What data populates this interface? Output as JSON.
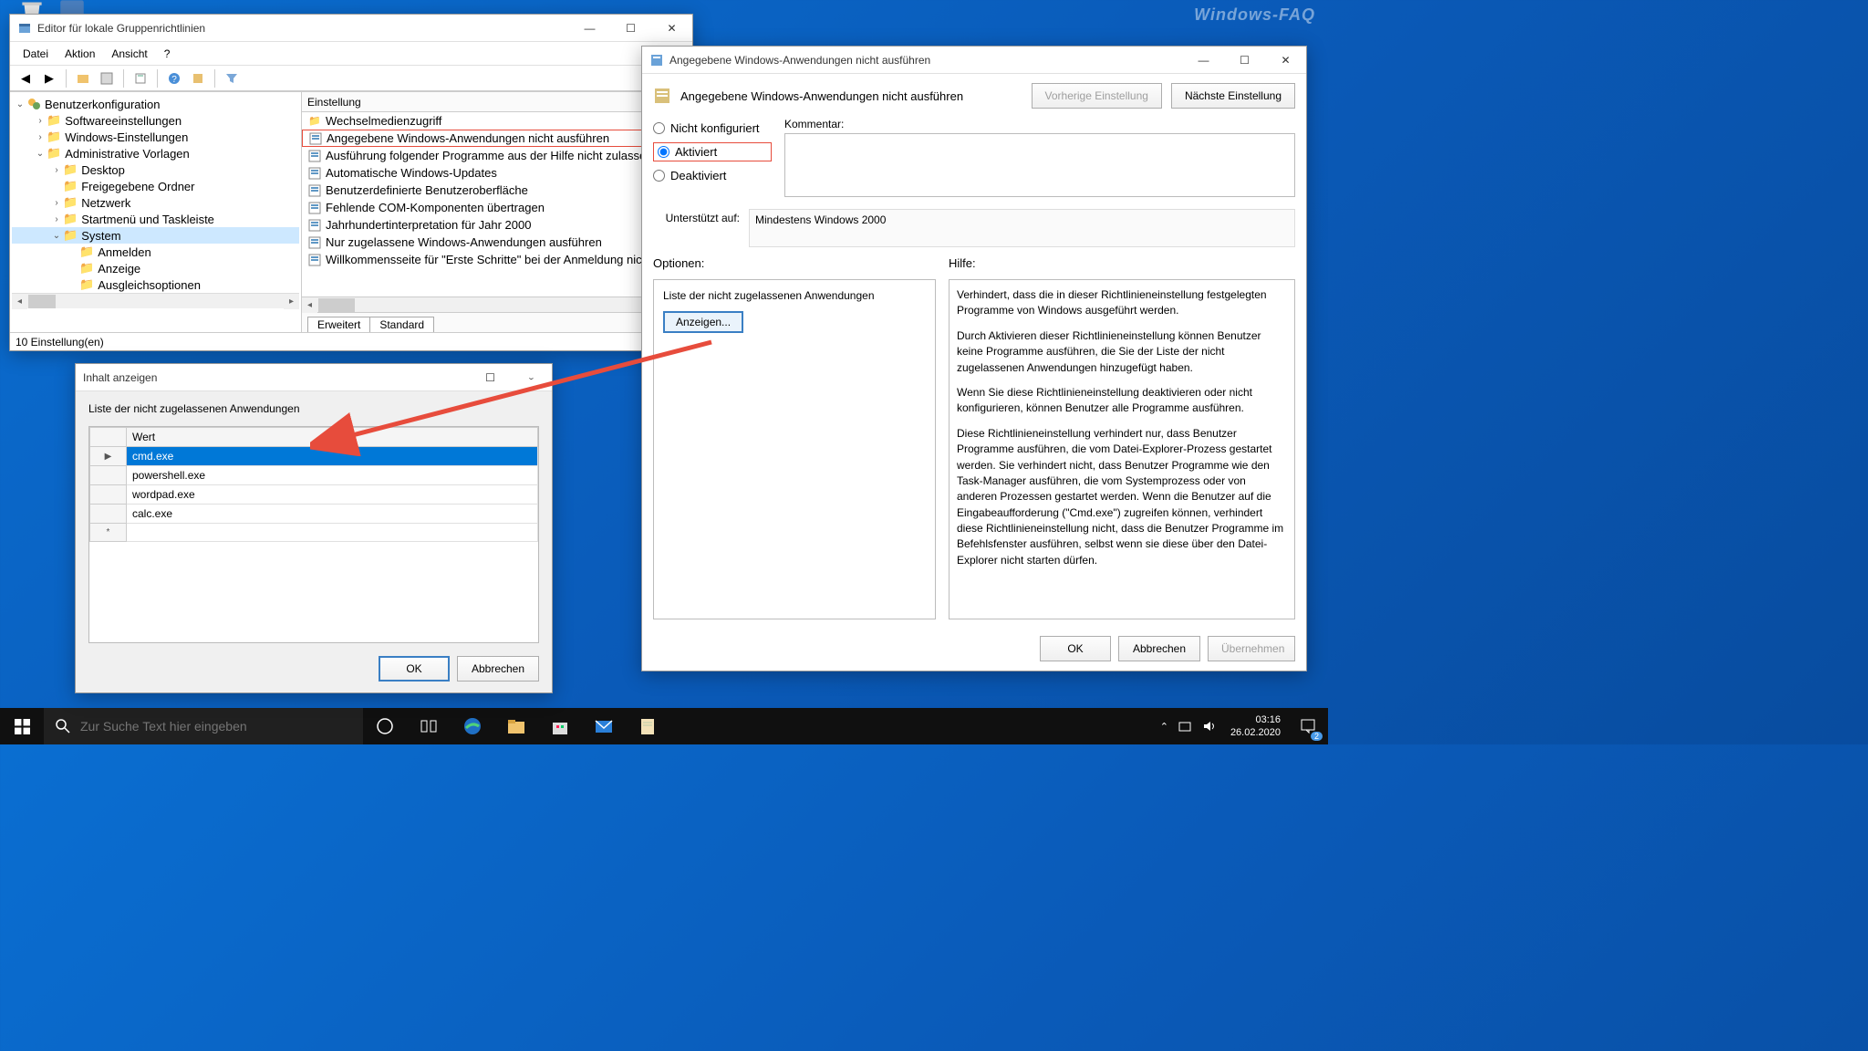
{
  "watermark": "Windows-FAQ",
  "desktop": {
    "icons": [
      "recycle-bin",
      "this-pc"
    ]
  },
  "gpe": {
    "title": "Editor für lokale Gruppenrichtlinien",
    "menus": [
      "Datei",
      "Aktion",
      "Ansicht",
      "?"
    ],
    "tree": {
      "root": "Benutzerkonfiguration",
      "nodes": [
        {
          "label": "Softwareeinstellungen",
          "level": 1,
          "exp": "›"
        },
        {
          "label": "Windows-Einstellungen",
          "level": 1,
          "exp": "›"
        },
        {
          "label": "Administrative Vorlagen",
          "level": 1,
          "exp": "v"
        },
        {
          "label": "Desktop",
          "level": 2,
          "exp": "›"
        },
        {
          "label": "Freigegebene Ordner",
          "level": 2,
          "exp": ""
        },
        {
          "label": "Netzwerk",
          "level": 2,
          "exp": "›"
        },
        {
          "label": "Startmenü und Taskleiste",
          "level": 2,
          "exp": "›"
        },
        {
          "label": "System",
          "level": 2,
          "exp": "v",
          "sel": true
        },
        {
          "label": "Anmelden",
          "level": 3,
          "exp": ""
        },
        {
          "label": "Anzeige",
          "level": 3,
          "exp": ""
        },
        {
          "label": "Ausgleichsoptionen",
          "level": 3,
          "exp": ""
        }
      ]
    },
    "list_header": "Einstellung",
    "settings": [
      {
        "icon": "folder",
        "label": "Wechselmedienzugriff"
      },
      {
        "icon": "policy",
        "label": "Angegebene Windows-Anwendungen nicht ausführen",
        "hl": true
      },
      {
        "icon": "policy",
        "label": "Ausführung folgender Programme aus der Hilfe nicht zulassen"
      },
      {
        "icon": "policy",
        "label": "Automatische Windows-Updates"
      },
      {
        "icon": "policy",
        "label": "Benutzerdefinierte Benutzeroberfläche"
      },
      {
        "icon": "policy",
        "label": "Fehlende COM-Komponenten übertragen"
      },
      {
        "icon": "policy",
        "label": "Jahrhundertinterpretation für Jahr 2000"
      },
      {
        "icon": "policy",
        "label": "Nur zugelassene Windows-Anwendungen ausführen"
      },
      {
        "icon": "policy",
        "label": "Willkommensseite für \"Erste Schritte\" bei der Anmeldung nic..."
      }
    ],
    "tabs": [
      "Erweitert",
      "Standard"
    ],
    "status": "10 Einstellung(en)"
  },
  "policy": {
    "title": "Angegebene Windows-Anwendungen nicht ausführen",
    "heading": "Angegebene Windows-Anwendungen nicht ausführen",
    "prev_btn": "Vorherige Einstellung",
    "next_btn": "Nächste Einstellung",
    "radio_not_configured": "Nicht konfiguriert",
    "radio_enabled": "Aktiviert",
    "radio_disabled": "Deaktiviert",
    "selected": "enabled",
    "comment_label": "Kommentar:",
    "comment_value": "",
    "supported_label": "Unterstützt auf:",
    "supported_value": "Mindestens Windows 2000",
    "options_label": "Optionen:",
    "help_label": "Hilfe:",
    "options_list_label": "Liste der nicht zugelassenen Anwendungen",
    "show_btn": "Anzeigen...",
    "help_paragraphs": [
      "Verhindert, dass die in dieser Richtlinieneinstellung festgelegten Programme von Windows ausgeführt werden.",
      "Durch Aktivieren dieser Richtlinieneinstellung können Benutzer keine Programme ausführen, die Sie der Liste der nicht zugelassenen Anwendungen hinzugefügt haben.",
      "Wenn Sie diese Richtlinieneinstellung deaktivieren oder nicht konfigurieren, können Benutzer alle Programme ausführen.",
      "Diese Richtlinieneinstellung verhindert nur, dass Benutzer Programme ausführen, die vom Datei-Explorer-Prozess gestartet werden. Sie verhindert nicht, dass Benutzer Programme wie den Task-Manager ausführen, die vom Systemprozess oder von anderen Prozessen gestartet werden.  Wenn die Benutzer auf die Eingabeaufforderung (\"Cmd.exe\") zugreifen können, verhindert diese Richtlinieneinstellung nicht, dass die Benutzer Programme im Befehlsfenster ausführen, selbst wenn sie diese über den Datei-Explorer nicht starten dürfen."
    ],
    "ok": "OK",
    "cancel": "Abbrechen",
    "apply": "Übernehmen"
  },
  "show": {
    "title": "Inhalt anzeigen",
    "list_label": "Liste der nicht zugelassenen Anwendungen",
    "col_value": "Wert",
    "rows": [
      {
        "v": "cmd.exe",
        "sel": true,
        "mark": "▶"
      },
      {
        "v": "powershell.exe"
      },
      {
        "v": "wordpad.exe"
      },
      {
        "v": "calc.exe"
      },
      {
        "v": "",
        "mark": "*"
      }
    ],
    "ok": "OK",
    "cancel": "Abbrechen"
  },
  "taskbar": {
    "search_placeholder": "Zur Suche Text hier eingeben",
    "clock_time": "03:16",
    "clock_date": "26.02.2020",
    "notif_count": "2"
  }
}
